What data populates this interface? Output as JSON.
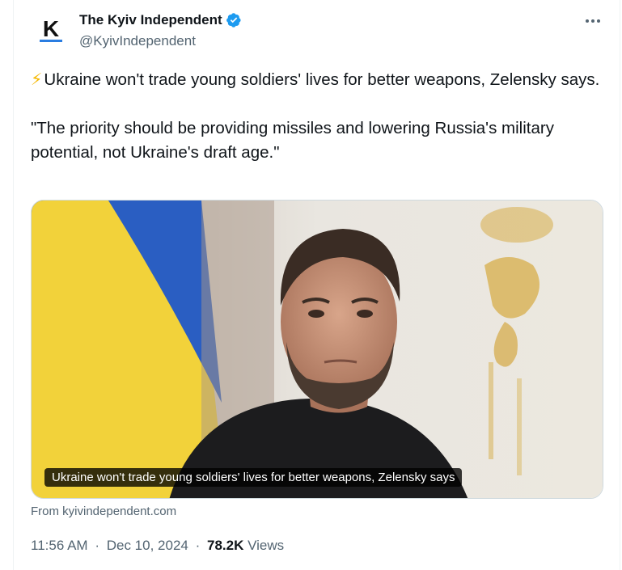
{
  "author": {
    "display_name": "The Kyiv Independent",
    "handle": "@KyivIndependent",
    "avatar_letter": "K",
    "verified_icon": "verified-badge-icon",
    "verified_color": "#1d9bf0"
  },
  "menu_icon": "more-dots-icon",
  "tweet": {
    "bolt_icon": "⚡",
    "line1": "Ukraine won't trade young soldiers' lives for better weapons, Zelensky says.",
    "line2": "\"The priority should be providing missiles and lowering Russia's military potential, not Ukraine's draft age.\""
  },
  "card": {
    "title": "Ukraine won't trade young soldiers' lives for better weapons, Zelensky says",
    "source": "From kyivindependent.com",
    "image": "Zelensky portrait in front of Ukrainian flag"
  },
  "meta": {
    "time": "11:56 AM",
    "separator": "·",
    "date": "Dec 10, 2024",
    "views_count": "78.2K",
    "views_label": "Views"
  }
}
